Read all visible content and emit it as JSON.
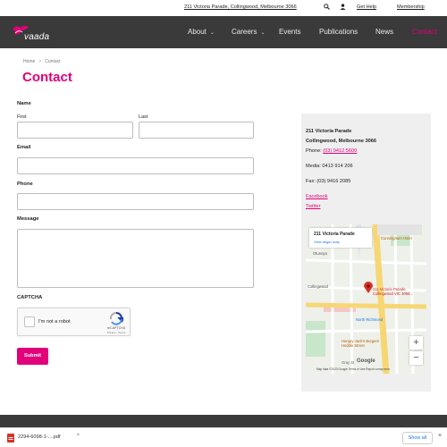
{
  "utility": {
    "address": "211 Victoria Parade, Collingwood, Melbourne 3066",
    "help": "Get Help",
    "membership": "Membership",
    "icons": [
      "search-icon",
      "user-icon"
    ]
  },
  "nav": {
    "logo_text": "vaada",
    "items": [
      {
        "label": "About",
        "chevron": "⌄"
      },
      {
        "label": "Careers",
        "chevron": "⌄"
      },
      {
        "label": "Events"
      },
      {
        "label": "Publications"
      },
      {
        "label": "News"
      },
      {
        "label": "Contact"
      }
    ],
    "active": "Contact"
  },
  "breadcrumb": {
    "home": "Home",
    "sep": ">",
    "current": "Contact"
  },
  "page_title": "Contact",
  "form": {
    "name_label": "Name",
    "first_label": "First",
    "last_label": "Last",
    "email_label": "Email",
    "phone_label": "Phone",
    "message_label": "Message",
    "captcha_label": "CAPTCHA",
    "captcha": {
      "text": "I'm not a robot",
      "brand": "reCAPTCHA",
      "terms": "Privacy - Terms"
    },
    "submit_label": "Submit"
  },
  "sidebar": {
    "address1": "211 Victoria Parade",
    "address2": "Collingwood, Melbourne 3066",
    "phone_prefix": "Phone:",
    "phone": "(03) 9412 5600",
    "media": "Media: 0413 914 206",
    "fax": "Fax: (03) 9416 2085",
    "facebook": "Facebook",
    "twitter": "Twitter"
  },
  "map": {
    "card_title": "211 Victoria Parade",
    "card_link": "View larger map",
    "pin_label": "211 Victoria Parade, Collingwood VIC 3066...",
    "places": [
      "Cunningham Hotel",
      "Otunoya",
      "Collingwood",
      "North Richmond",
      "Hungry Jack's Burgers Hoddle Street",
      "Gray St"
    ],
    "zoom_in": "+",
    "zoom_out": "−",
    "footer": "Map data ©2023 Google   Terms of Use   Report a map error",
    "google": "Google",
    "colors": {
      "road_major": "#f7d774",
      "water": "#aadaff",
      "park": "#c8e6c9",
      "pin": "#d93025"
    }
  },
  "downloads": {
    "file": "2294-6098-1-....pdf",
    "show_all": "Show all",
    "close": "×"
  },
  "colors": {
    "accent": "#e2007a",
    "nav_bg": "#3a3a3a",
    "sidebar_bg": "#efefef"
  }
}
